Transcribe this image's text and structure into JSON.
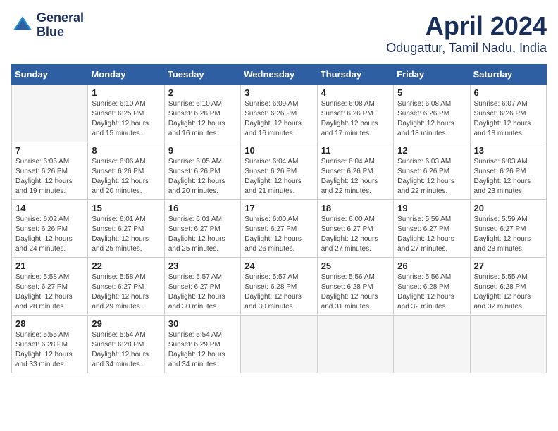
{
  "header": {
    "logo_line1": "General",
    "logo_line2": "Blue",
    "month": "April 2024",
    "location": "Odugattur, Tamil Nadu, India"
  },
  "weekdays": [
    "Sunday",
    "Monday",
    "Tuesday",
    "Wednesday",
    "Thursday",
    "Friday",
    "Saturday"
  ],
  "weeks": [
    [
      {
        "day": "",
        "sunrise": "",
        "sunset": "",
        "daylight": "",
        "empty": true
      },
      {
        "day": "1",
        "sunrise": "Sunrise: 6:10 AM",
        "sunset": "Sunset: 6:25 PM",
        "daylight": "Daylight: 12 hours and 15 minutes.",
        "empty": false
      },
      {
        "day": "2",
        "sunrise": "Sunrise: 6:10 AM",
        "sunset": "Sunset: 6:26 PM",
        "daylight": "Daylight: 12 hours and 16 minutes.",
        "empty": false
      },
      {
        "day": "3",
        "sunrise": "Sunrise: 6:09 AM",
        "sunset": "Sunset: 6:26 PM",
        "daylight": "Daylight: 12 hours and 16 minutes.",
        "empty": false
      },
      {
        "day": "4",
        "sunrise": "Sunrise: 6:08 AM",
        "sunset": "Sunset: 6:26 PM",
        "daylight": "Daylight: 12 hours and 17 minutes.",
        "empty": false
      },
      {
        "day": "5",
        "sunrise": "Sunrise: 6:08 AM",
        "sunset": "Sunset: 6:26 PM",
        "daylight": "Daylight: 12 hours and 18 minutes.",
        "empty": false
      },
      {
        "day": "6",
        "sunrise": "Sunrise: 6:07 AM",
        "sunset": "Sunset: 6:26 PM",
        "daylight": "Daylight: 12 hours and 18 minutes.",
        "empty": false
      }
    ],
    [
      {
        "day": "7",
        "sunrise": "Sunrise: 6:06 AM",
        "sunset": "Sunset: 6:26 PM",
        "daylight": "Daylight: 12 hours and 19 minutes.",
        "empty": false
      },
      {
        "day": "8",
        "sunrise": "Sunrise: 6:06 AM",
        "sunset": "Sunset: 6:26 PM",
        "daylight": "Daylight: 12 hours and 20 minutes.",
        "empty": false
      },
      {
        "day": "9",
        "sunrise": "Sunrise: 6:05 AM",
        "sunset": "Sunset: 6:26 PM",
        "daylight": "Daylight: 12 hours and 20 minutes.",
        "empty": false
      },
      {
        "day": "10",
        "sunrise": "Sunrise: 6:04 AM",
        "sunset": "Sunset: 6:26 PM",
        "daylight": "Daylight: 12 hours and 21 minutes.",
        "empty": false
      },
      {
        "day": "11",
        "sunrise": "Sunrise: 6:04 AM",
        "sunset": "Sunset: 6:26 PM",
        "daylight": "Daylight: 12 hours and 22 minutes.",
        "empty": false
      },
      {
        "day": "12",
        "sunrise": "Sunrise: 6:03 AM",
        "sunset": "Sunset: 6:26 PM",
        "daylight": "Daylight: 12 hours and 22 minutes.",
        "empty": false
      },
      {
        "day": "13",
        "sunrise": "Sunrise: 6:03 AM",
        "sunset": "Sunset: 6:26 PM",
        "daylight": "Daylight: 12 hours and 23 minutes.",
        "empty": false
      }
    ],
    [
      {
        "day": "14",
        "sunrise": "Sunrise: 6:02 AM",
        "sunset": "Sunset: 6:26 PM",
        "daylight": "Daylight: 12 hours and 24 minutes.",
        "empty": false
      },
      {
        "day": "15",
        "sunrise": "Sunrise: 6:01 AM",
        "sunset": "Sunset: 6:27 PM",
        "daylight": "Daylight: 12 hours and 25 minutes.",
        "empty": false
      },
      {
        "day": "16",
        "sunrise": "Sunrise: 6:01 AM",
        "sunset": "Sunset: 6:27 PM",
        "daylight": "Daylight: 12 hours and 25 minutes.",
        "empty": false
      },
      {
        "day": "17",
        "sunrise": "Sunrise: 6:00 AM",
        "sunset": "Sunset: 6:27 PM",
        "daylight": "Daylight: 12 hours and 26 minutes.",
        "empty": false
      },
      {
        "day": "18",
        "sunrise": "Sunrise: 6:00 AM",
        "sunset": "Sunset: 6:27 PM",
        "daylight": "Daylight: 12 hours and 27 minutes.",
        "empty": false
      },
      {
        "day": "19",
        "sunrise": "Sunrise: 5:59 AM",
        "sunset": "Sunset: 6:27 PM",
        "daylight": "Daylight: 12 hours and 27 minutes.",
        "empty": false
      },
      {
        "day": "20",
        "sunrise": "Sunrise: 5:59 AM",
        "sunset": "Sunset: 6:27 PM",
        "daylight": "Daylight: 12 hours and 28 minutes.",
        "empty": false
      }
    ],
    [
      {
        "day": "21",
        "sunrise": "Sunrise: 5:58 AM",
        "sunset": "Sunset: 6:27 PM",
        "daylight": "Daylight: 12 hours and 28 minutes.",
        "empty": false
      },
      {
        "day": "22",
        "sunrise": "Sunrise: 5:58 AM",
        "sunset": "Sunset: 6:27 PM",
        "daylight": "Daylight: 12 hours and 29 minutes.",
        "empty": false
      },
      {
        "day": "23",
        "sunrise": "Sunrise: 5:57 AM",
        "sunset": "Sunset: 6:27 PM",
        "daylight": "Daylight: 12 hours and 30 minutes.",
        "empty": false
      },
      {
        "day": "24",
        "sunrise": "Sunrise: 5:57 AM",
        "sunset": "Sunset: 6:28 PM",
        "daylight": "Daylight: 12 hours and 30 minutes.",
        "empty": false
      },
      {
        "day": "25",
        "sunrise": "Sunrise: 5:56 AM",
        "sunset": "Sunset: 6:28 PM",
        "daylight": "Daylight: 12 hours and 31 minutes.",
        "empty": false
      },
      {
        "day": "26",
        "sunrise": "Sunrise: 5:56 AM",
        "sunset": "Sunset: 6:28 PM",
        "daylight": "Daylight: 12 hours and 32 minutes.",
        "empty": false
      },
      {
        "day": "27",
        "sunrise": "Sunrise: 5:55 AM",
        "sunset": "Sunset: 6:28 PM",
        "daylight": "Daylight: 12 hours and 32 minutes.",
        "empty": false
      }
    ],
    [
      {
        "day": "28",
        "sunrise": "Sunrise: 5:55 AM",
        "sunset": "Sunset: 6:28 PM",
        "daylight": "Daylight: 12 hours and 33 minutes.",
        "empty": false
      },
      {
        "day": "29",
        "sunrise": "Sunrise: 5:54 AM",
        "sunset": "Sunset: 6:28 PM",
        "daylight": "Daylight: 12 hours and 34 minutes.",
        "empty": false
      },
      {
        "day": "30",
        "sunrise": "Sunrise: 5:54 AM",
        "sunset": "Sunset: 6:29 PM",
        "daylight": "Daylight: 12 hours and 34 minutes.",
        "empty": false
      },
      {
        "day": "",
        "sunrise": "",
        "sunset": "",
        "daylight": "",
        "empty": true
      },
      {
        "day": "",
        "sunrise": "",
        "sunset": "",
        "daylight": "",
        "empty": true
      },
      {
        "day": "",
        "sunrise": "",
        "sunset": "",
        "daylight": "",
        "empty": true
      },
      {
        "day": "",
        "sunrise": "",
        "sunset": "",
        "daylight": "",
        "empty": true
      }
    ]
  ]
}
